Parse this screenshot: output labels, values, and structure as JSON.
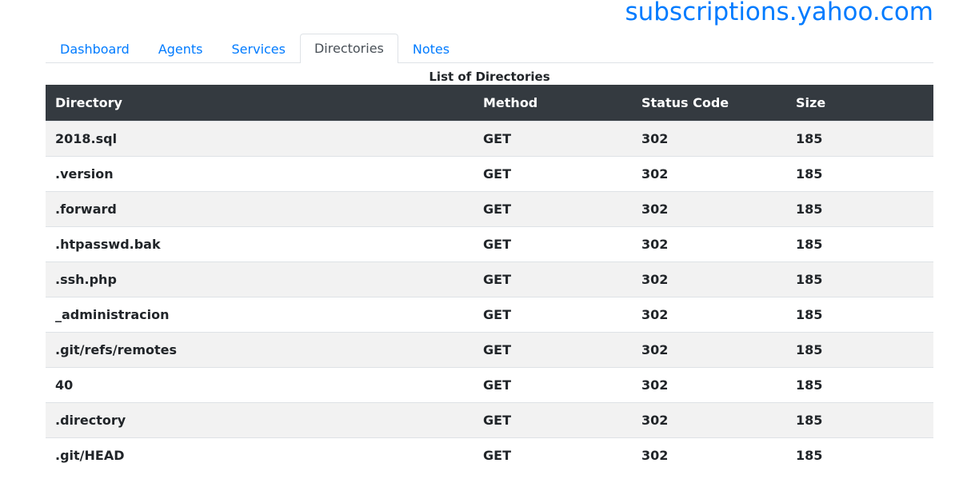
{
  "header": {
    "host": "subscriptions.yahoo.com"
  },
  "tabs": [
    {
      "label": "Dashboard",
      "active": false
    },
    {
      "label": "Agents",
      "active": false
    },
    {
      "label": "Services",
      "active": false
    },
    {
      "label": "Directories",
      "active": true
    },
    {
      "label": "Notes",
      "active": false
    }
  ],
  "table": {
    "caption": "List of Directories",
    "columns": [
      "Directory",
      "Method",
      "Status Code",
      "Size"
    ],
    "rows": [
      {
        "directory": "2018.sql",
        "method": "GET",
        "status": "302",
        "size": "185"
      },
      {
        "directory": ".version",
        "method": "GET",
        "status": "302",
        "size": "185"
      },
      {
        "directory": ".forward",
        "method": "GET",
        "status": "302",
        "size": "185"
      },
      {
        "directory": ".htpasswd.bak",
        "method": "GET",
        "status": "302",
        "size": "185"
      },
      {
        "directory": ".ssh.php",
        "method": "GET",
        "status": "302",
        "size": "185"
      },
      {
        "directory": "_administracion",
        "method": "GET",
        "status": "302",
        "size": "185"
      },
      {
        "directory": ".git/refs/remotes",
        "method": "GET",
        "status": "302",
        "size": "185"
      },
      {
        "directory": "40",
        "method": "GET",
        "status": "302",
        "size": "185"
      },
      {
        "directory": ".directory",
        "method": "GET",
        "status": "302",
        "size": "185"
      },
      {
        "directory": ".git/HEAD",
        "method": "GET",
        "status": "302",
        "size": "185"
      }
    ]
  },
  "colors": {
    "link": "#007bff",
    "header_bg": "#343a40",
    "stripe": "#f2f2f2"
  }
}
